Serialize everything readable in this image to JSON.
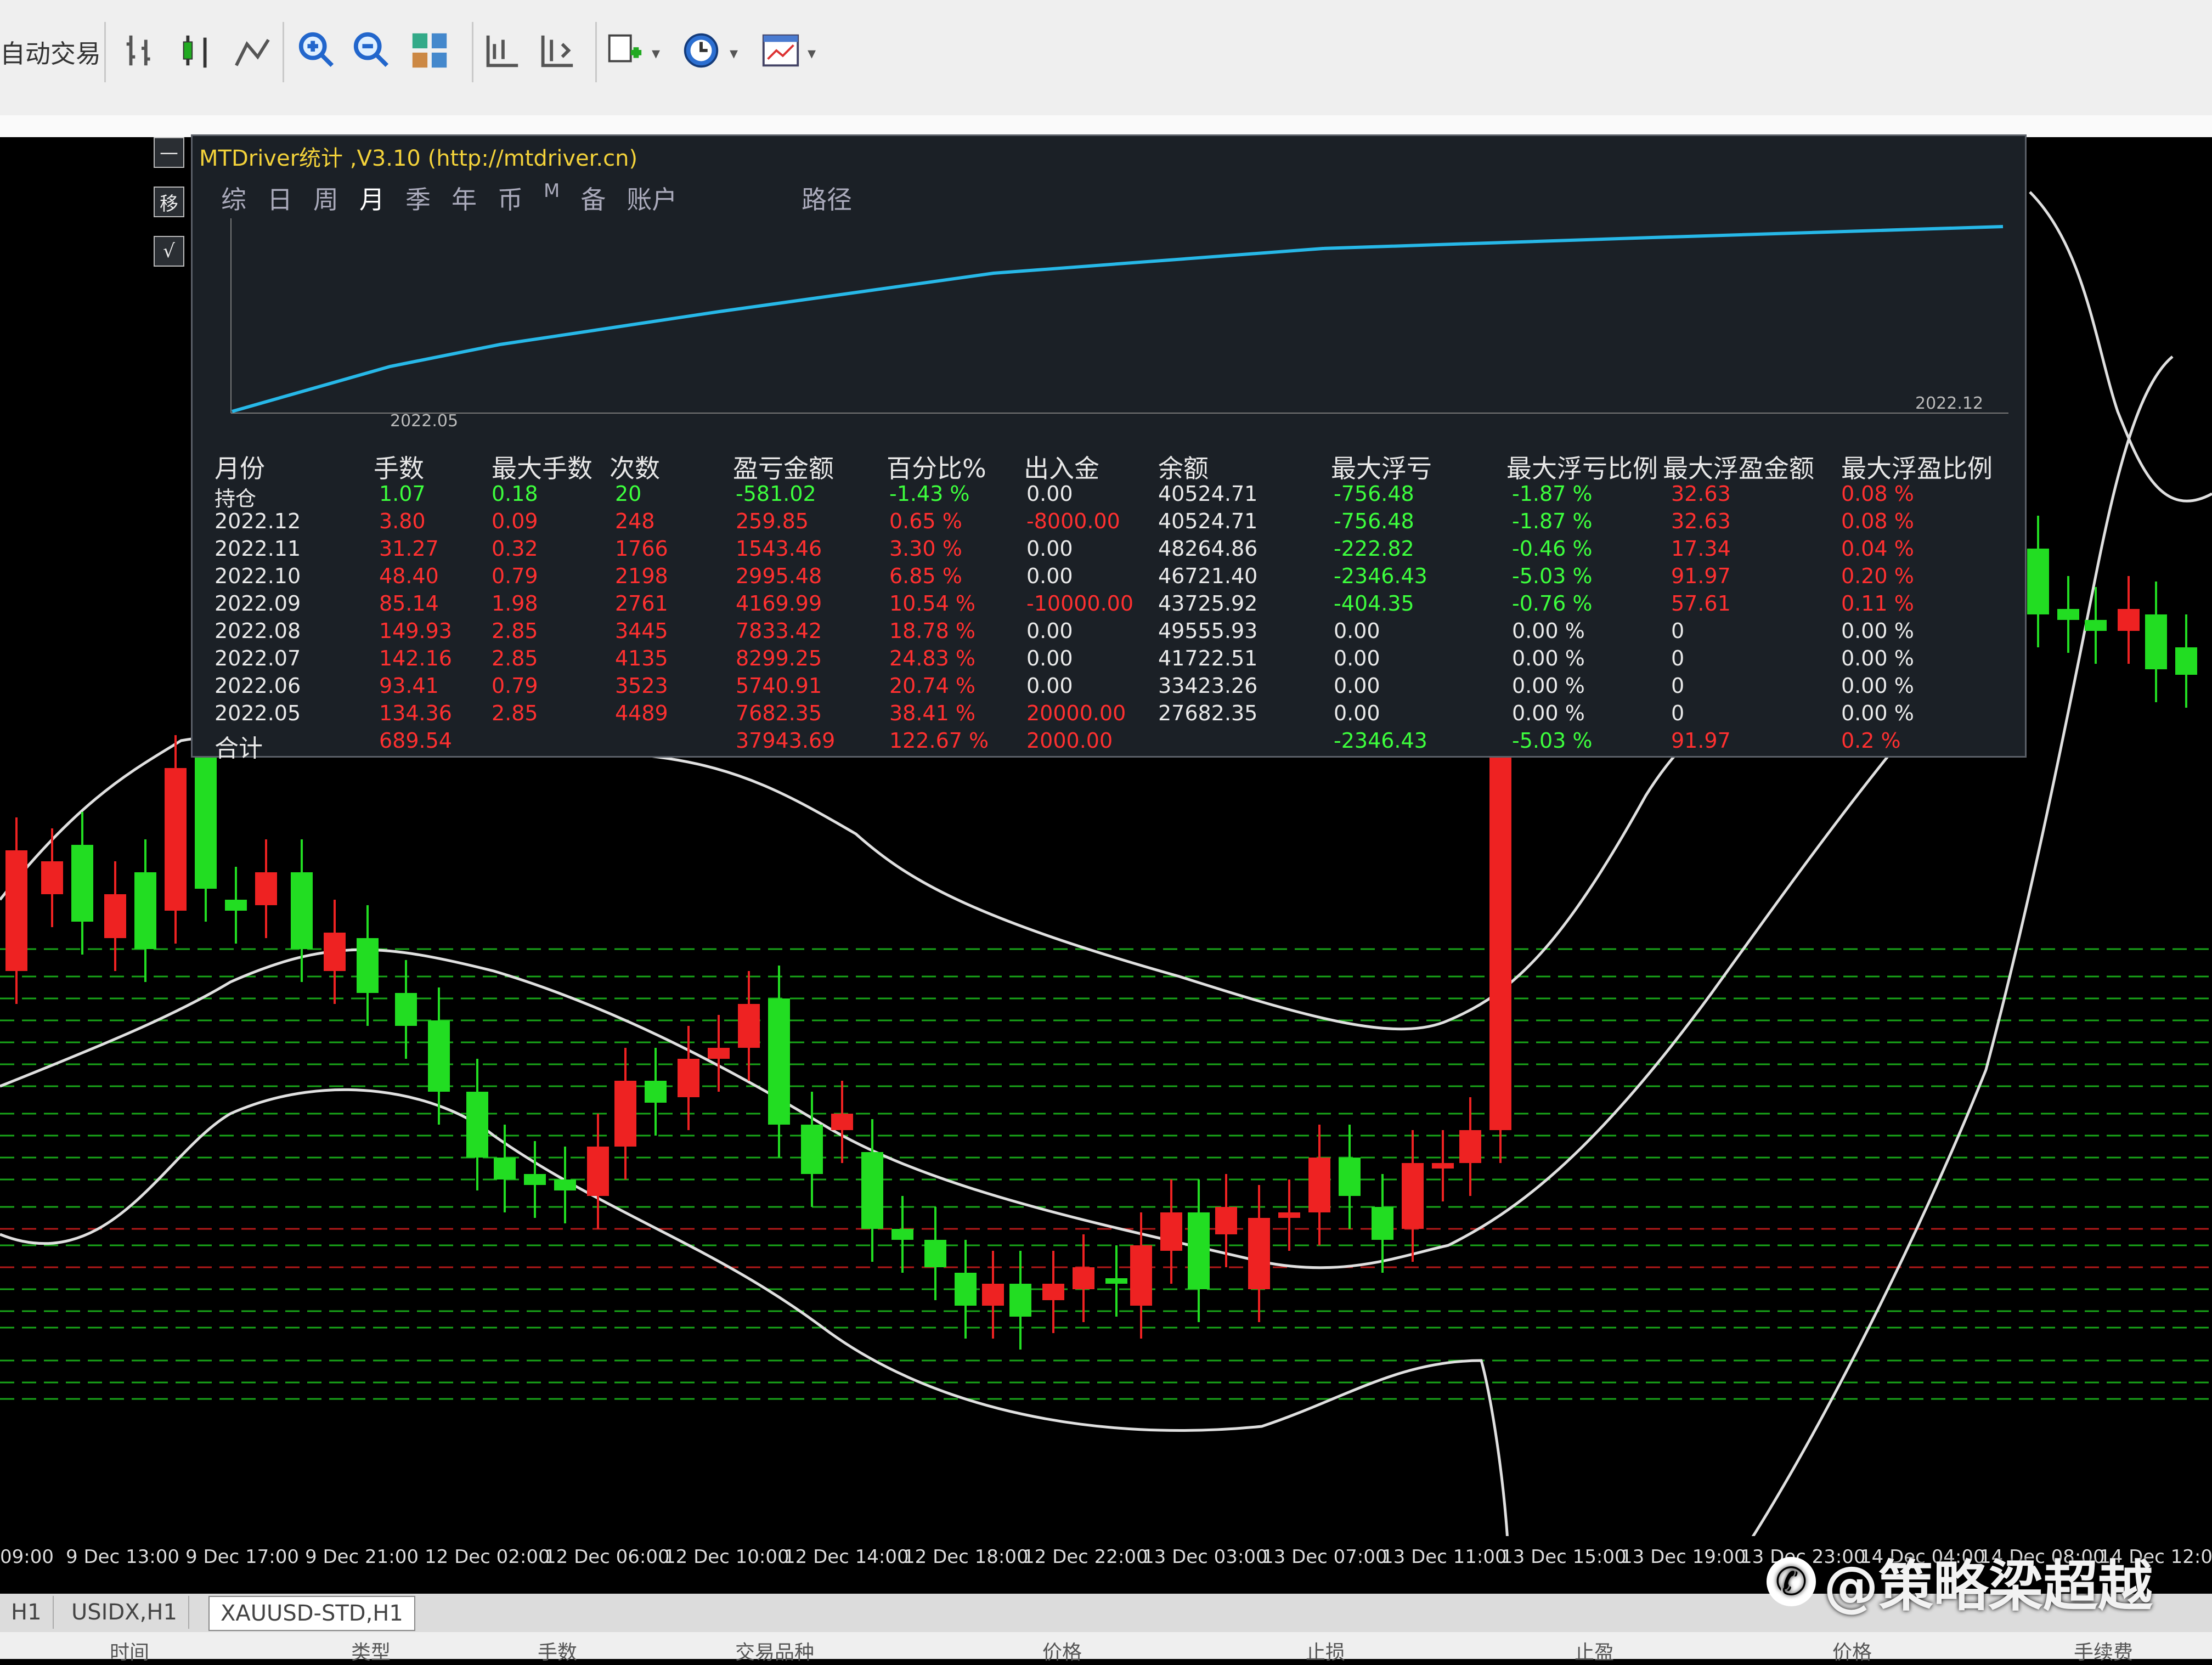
{
  "toolbar": {
    "auto_trade_label": "自动交易",
    "buttons": [
      "bar-chart",
      "candle-chart",
      "line-chart",
      "zoom-in",
      "zoom-out",
      "tile-windows",
      "chart-shift",
      "autoscroll",
      "indicators",
      "periods",
      "templates"
    ]
  },
  "panel": {
    "title": "MTDriver统计 ,V3.10 (http://mtdriver.cn)",
    "side_buttons": [
      "—",
      "移",
      "√"
    ],
    "tabs": [
      "综",
      "日",
      "周",
      "月",
      "季",
      "年",
      "币",
      "M",
      "备",
      "账户"
    ],
    "active_tab": "月",
    "path_label": "路径",
    "mini_chart": {
      "start_label": "2022.05",
      "end_label": "2022.12"
    },
    "headers": [
      "月份",
      "手数",
      "最大手数",
      "次数",
      "盈亏金额",
      "百分比%",
      "出入金",
      "余额",
      "最大浮亏",
      "最大浮亏比例",
      "最大浮盈金额",
      "最大浮盈比例"
    ],
    "rows": [
      {
        "month": "持仓",
        "lots": "1.07",
        "max_lots": "0.18",
        "count": "20",
        "pnl": "-581.02",
        "pct": "-1.43 %",
        "flow": "0.00",
        "balance": "40524.71",
        "max_float_loss": "-756.48",
        "max_float_loss_pct": "-1.87 %",
        "max_float_profit": "32.63",
        "max_float_profit_pct": "0.08 %"
      },
      {
        "month": "2022.12",
        "lots": "3.80",
        "max_lots": "0.09",
        "count": "248",
        "pnl": "259.85",
        "pct": "0.65 %",
        "flow": "-8000.00",
        "balance": "40524.71",
        "max_float_loss": "-756.48",
        "max_float_loss_pct": "-1.87 %",
        "max_float_profit": "32.63",
        "max_float_profit_pct": "0.08 %"
      },
      {
        "month": "2022.11",
        "lots": "31.27",
        "max_lots": "0.32",
        "count": "1766",
        "pnl": "1543.46",
        "pct": "3.30 %",
        "flow": "0.00",
        "balance": "48264.86",
        "max_float_loss": "-222.82",
        "max_float_loss_pct": "-0.46 %",
        "max_float_profit": "17.34",
        "max_float_profit_pct": "0.04 %"
      },
      {
        "month": "2022.10",
        "lots": "48.40",
        "max_lots": "0.79",
        "count": "2198",
        "pnl": "2995.48",
        "pct": "6.85 %",
        "flow": "0.00",
        "balance": "46721.40",
        "max_float_loss": "-2346.43",
        "max_float_loss_pct": "-5.03 %",
        "max_float_profit": "91.97",
        "max_float_profit_pct": "0.20 %"
      },
      {
        "month": "2022.09",
        "lots": "85.14",
        "max_lots": "1.98",
        "count": "2761",
        "pnl": "4169.99",
        "pct": "10.54 %",
        "flow": "-10000.00",
        "balance": "43725.92",
        "max_float_loss": "-404.35",
        "max_float_loss_pct": "-0.76 %",
        "max_float_profit": "57.61",
        "max_float_profit_pct": "0.11 %"
      },
      {
        "month": "2022.08",
        "lots": "149.93",
        "max_lots": "2.85",
        "count": "3445",
        "pnl": "7833.42",
        "pct": "18.78 %",
        "flow": "0.00",
        "balance": "49555.93",
        "max_float_loss": "0.00",
        "max_float_loss_pct": "0.00 %",
        "max_float_profit": "0",
        "max_float_profit_pct": "0.00 %"
      },
      {
        "month": "2022.07",
        "lots": "142.16",
        "max_lots": "2.85",
        "count": "4135",
        "pnl": "8299.25",
        "pct": "24.83 %",
        "flow": "0.00",
        "balance": "41722.51",
        "max_float_loss": "0.00",
        "max_float_loss_pct": "0.00 %",
        "max_float_profit": "0",
        "max_float_profit_pct": "0.00 %"
      },
      {
        "month": "2022.06",
        "lots": "93.41",
        "max_lots": "0.79",
        "count": "3523",
        "pnl": "5740.91",
        "pct": "20.74 %",
        "flow": "0.00",
        "balance": "33423.26",
        "max_float_loss": "0.00",
        "max_float_loss_pct": "0.00 %",
        "max_float_profit": "0",
        "max_float_profit_pct": "0.00 %"
      },
      {
        "month": "2022.05",
        "lots": "134.36",
        "max_lots": "2.85",
        "count": "4489",
        "pnl": "7682.35",
        "pct": "38.41 %",
        "flow": "20000.00",
        "balance": "27682.35",
        "max_float_loss": "0.00",
        "max_float_loss_pct": "0.00 %",
        "max_float_profit": "0",
        "max_float_profit_pct": "0.00 %"
      },
      {
        "month": "合计",
        "lots": "689.54",
        "max_lots": "",
        "count": "",
        "pnl": "37943.69",
        "pct": "122.67 %",
        "flow": "2000.00",
        "balance": "",
        "max_float_loss": "-2346.43",
        "max_float_loss_pct": "-5.03 %",
        "max_float_profit": "91.97",
        "max_float_profit_pct": "0.2 %"
      }
    ]
  },
  "time_axis": [
    "09:00",
    "9 Dec 13:00",
    "9 Dec 17:00",
    "9 Dec 21:00",
    "12 Dec 02:00",
    "12 Dec 06:00",
    "12 Dec 10:00",
    "12 Dec 14:00",
    "12 Dec 18:00",
    "12 Dec 22:00",
    "13 Dec 03:00",
    "13 Dec 07:00",
    "13 Dec 11:00",
    "13 Dec 15:00",
    "13 Dec 19:00",
    "13 Dec 23:00",
    "14 Dec 04:00",
    "14 Dec 08:00",
    "14 Dec 12:00"
  ],
  "symbol_tabs": [
    "H1",
    "USIDX,H1",
    "XAUUSD-STD,H1"
  ],
  "active_symbol_tab": "XAUUSD-STD,H1",
  "bottom_columns": [
    "时间",
    "类型",
    "手数",
    "交易品种",
    "价格",
    "止损",
    "止盈",
    "价格",
    "手续费"
  ],
  "watermark": "@策略梁超越",
  "colors": {
    "bull": "#22dd22",
    "bear": "#ee2222",
    "equity_line": "#27b8e8",
    "title": "#f3d23a"
  }
}
